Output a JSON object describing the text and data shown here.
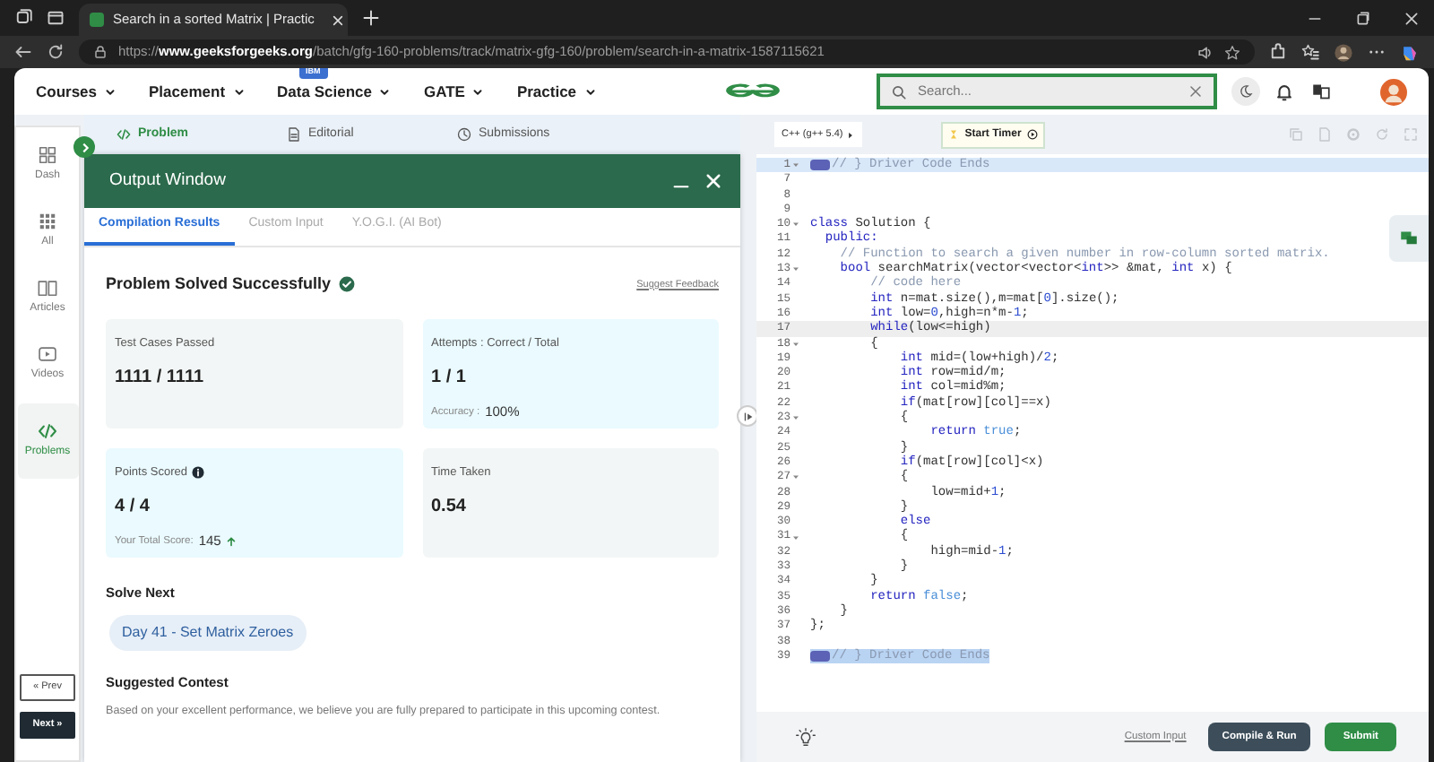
{
  "browser": {
    "tab_title": "Search in a sorted Matrix | Practic",
    "url": "https://**www.geeksforgeeks.org**/batch/gfg-160-problems/track/matrix-gfg-160/problem/search-in-a-matrix-1587115621"
  },
  "nav": {
    "items": [
      {
        "label": "Courses"
      },
      {
        "label": "Placement"
      },
      {
        "label": "Data Science",
        "badge": "IBM"
      },
      {
        "label": "GATE"
      },
      {
        "label": "Practice"
      }
    ],
    "search_placeholder": "Search..."
  },
  "sidebar": {
    "items": [
      {
        "label": "Dash",
        "kind": "dash",
        "selected": false
      },
      {
        "label": "All",
        "kind": "all",
        "selected": false
      },
      {
        "label": "Articles",
        "kind": "book",
        "selected": false
      },
      {
        "label": "Videos",
        "kind": "video",
        "selected": false
      },
      {
        "label": "Problems",
        "kind": "code",
        "selected": true
      }
    ],
    "prev": "« Prev",
    "next": "Next »"
  },
  "problem_tabs": [
    {
      "label": "Problem",
      "kind": "code",
      "selected": true
    },
    {
      "label": "Editorial",
      "kind": "doc",
      "selected": false
    },
    {
      "label": "Submissions",
      "kind": "clock",
      "selected": false
    }
  ],
  "output_window": {
    "title": "Output Window",
    "tabs": [
      {
        "label": "Compilation Results",
        "selected": true
      },
      {
        "label": "Custom Input",
        "selected": false
      },
      {
        "label": "Y.O.G.I. (AI Bot)",
        "selected": false
      }
    ],
    "status": "Problem Solved Successfully",
    "solved": true,
    "feedback_link": "Suggest Feedback",
    "stats": [
      {
        "label": "Test Cases Passed",
        "value": "1111 / 1111",
        "kind": "plain",
        "info_icon": false
      },
      {
        "label": "Attempts : Correct / Total",
        "value": "1 / 1",
        "note_label": "Accuracy :",
        "note_value": "100%",
        "kind": "highlight",
        "info_icon": false,
        "trend_up": false
      },
      {
        "label": "Points Scored",
        "value": "4 / 4",
        "note_label": "Your Total Score:",
        "note_value": "145",
        "trend_up": true,
        "kind": "highlight",
        "info_icon": true
      },
      {
        "label": "Time Taken",
        "value": "0.54",
        "kind": "plain",
        "info_icon": false
      }
    ],
    "solve_next_heading": "Solve Next",
    "solve_next": "Day 41 - Set Matrix Zeroes",
    "contest_heading": "Suggested Contest",
    "contest_text": "Based on your excellent performance, we believe you are fully prepared to participate in this upcoming contest."
  },
  "editor": {
    "language": "C++ (g++ 5.4)",
    "timer": "Start Timer",
    "custom_input": "Custom Input",
    "compile": "Compile & Run",
    "submit": "Submit",
    "lines": [
      {
        "n": "1",
        "fold": true,
        "marker": true,
        "kind": "active",
        "tokens": [
          {
            "text": "// } Driver Code Ends",
            "kind": "comment"
          }
        ]
      },
      {
        "n": "7",
        "fold": false,
        "marker": false,
        "kind": "plain"
      },
      {
        "n": "8",
        "fold": false,
        "marker": false,
        "kind": "plain"
      },
      {
        "n": "9",
        "fold": false,
        "marker": false,
        "kind": "plain"
      },
      {
        "n": "10",
        "fold": true,
        "marker": false,
        "kind": "plain",
        "tokens": [
          {
            "text": "class",
            "kind": "keyword"
          },
          {
            "text": " Solution {",
            "kind": "plain"
          }
        ]
      },
      {
        "n": "11",
        "fold": false,
        "marker": false,
        "kind": "plain",
        "tokens": [
          {
            "text": "  public:",
            "kind": "keyword"
          }
        ]
      },
      {
        "n": "12",
        "fold": false,
        "marker": false,
        "kind": "plain",
        "tokens": [
          {
            "text": "    // Function to search a given number in row-column sorted matrix.",
            "kind": "comment"
          }
        ]
      },
      {
        "n": "13",
        "fold": true,
        "marker": false,
        "kind": "plain",
        "tokens": [
          {
            "text": "    bool",
            "kind": "keyword"
          },
          {
            "text": " searchMatrix(vector<vector<",
            "kind": "plain"
          },
          {
            "text": "int",
            "kind": "keyword"
          },
          {
            "text": ">> &mat, ",
            "kind": "plain"
          },
          {
            "text": "int",
            "kind": "keyword"
          },
          {
            "text": " x) {",
            "kind": "plain"
          }
        ]
      },
      {
        "n": "14",
        "fold": false,
        "marker": false,
        "kind": "plain",
        "tokens": [
          {
            "text": "        // code here",
            "kind": "comment"
          }
        ]
      },
      {
        "n": "15",
        "fold": false,
        "marker": false,
        "kind": "plain",
        "tokens": [
          {
            "text": "        int",
            "kind": "keyword"
          },
          {
            "text": " n=mat.size(),m=mat[",
            "kind": "plain"
          },
          {
            "text": "0",
            "kind": "number"
          },
          {
            "text": "].size();",
            "kind": "plain"
          }
        ]
      },
      {
        "n": "16",
        "fold": false,
        "marker": false,
        "kind": "plain",
        "tokens": [
          {
            "text": "        int",
            "kind": "keyword"
          },
          {
            "text": " low=",
            "kind": "plain"
          },
          {
            "text": "0",
            "kind": "number"
          },
          {
            "text": ",high=n*m-",
            "kind": "plain"
          },
          {
            "text": "1",
            "kind": "number"
          },
          {
            "text": ";",
            "kind": "plain"
          }
        ]
      },
      {
        "n": "17",
        "fold": false,
        "marker": false,
        "kind": "cursor",
        "tokens": [
          {
            "text": "        while",
            "kind": "keyword"
          },
          {
            "text": "(low<=high)",
            "kind": "plain"
          }
        ]
      },
      {
        "n": "18",
        "fold": true,
        "marker": false,
        "kind": "plain",
        "tokens": [
          {
            "text": "        {",
            "kind": "plain"
          }
        ]
      },
      {
        "n": "19",
        "fold": false,
        "marker": false,
        "kind": "plain",
        "tokens": [
          {
            "text": "            int",
            "kind": "keyword"
          },
          {
            "text": " mid=(low+high)/",
            "kind": "plain"
          },
          {
            "text": "2",
            "kind": "number"
          },
          {
            "text": ";",
            "kind": "plain"
          }
        ]
      },
      {
        "n": "20",
        "fold": false,
        "marker": false,
        "kind": "plain",
        "tokens": [
          {
            "text": "            int",
            "kind": "keyword"
          },
          {
            "text": " row=mid/m;",
            "kind": "plain"
          }
        ]
      },
      {
        "n": "21",
        "fold": false,
        "marker": false,
        "kind": "plain",
        "tokens": [
          {
            "text": "            int",
            "kind": "keyword"
          },
          {
            "text": " col=mid%m;",
            "kind": "plain"
          }
        ]
      },
      {
        "n": "22",
        "fold": false,
        "marker": false,
        "kind": "plain",
        "tokens": [
          {
            "text": "            if",
            "kind": "keyword"
          },
          {
            "text": "(mat[row][col]==x)",
            "kind": "plain"
          }
        ]
      },
      {
        "n": "23",
        "fold": true,
        "marker": false,
        "kind": "plain",
        "tokens": [
          {
            "text": "            {",
            "kind": "plain"
          }
        ]
      },
      {
        "n": "24",
        "fold": false,
        "marker": false,
        "kind": "plain",
        "tokens": [
          {
            "text": "                return ",
            "kind": "keyword"
          },
          {
            "text": "true",
            "kind": "boolean"
          },
          {
            "text": ";",
            "kind": "plain"
          }
        ]
      },
      {
        "n": "25",
        "fold": false,
        "marker": false,
        "kind": "plain",
        "tokens": [
          {
            "text": "            }",
            "kind": "plain"
          }
        ]
      },
      {
        "n": "26",
        "fold": false,
        "marker": false,
        "kind": "plain",
        "tokens": [
          {
            "text": "            if",
            "kind": "keyword"
          },
          {
            "text": "(mat[row][col]<x)",
            "kind": "plain"
          }
        ]
      },
      {
        "n": "27",
        "fold": true,
        "marker": false,
        "kind": "plain",
        "tokens": [
          {
            "text": "            {",
            "kind": "plain"
          }
        ]
      },
      {
        "n": "28",
        "fold": false,
        "marker": false,
        "kind": "plain",
        "tokens": [
          {
            "text": "                low=mid+",
            "kind": "plain"
          },
          {
            "text": "1",
            "kind": "number"
          },
          {
            "text": ";",
            "kind": "plain"
          }
        ]
      },
      {
        "n": "29",
        "fold": false,
        "marker": false,
        "kind": "plain",
        "tokens": [
          {
            "text": "            }",
            "kind": "plain"
          }
        ]
      },
      {
        "n": "30",
        "fold": false,
        "marker": false,
        "kind": "plain",
        "tokens": [
          {
            "text": "            else",
            "kind": "keyword"
          }
        ]
      },
      {
        "n": "31",
        "fold": true,
        "marker": false,
        "kind": "plain",
        "tokens": [
          {
            "text": "            {",
            "kind": "plain"
          }
        ]
      },
      {
        "n": "32",
        "fold": false,
        "marker": false,
        "kind": "plain",
        "tokens": [
          {
            "text": "                high=mid-",
            "kind": "plain"
          },
          {
            "text": "1",
            "kind": "number"
          },
          {
            "text": ";",
            "kind": "plain"
          }
        ]
      },
      {
        "n": "33",
        "fold": false,
        "marker": false,
        "kind": "plain",
        "tokens": [
          {
            "text": "            }",
            "kind": "plain"
          }
        ]
      },
      {
        "n": "34",
        "fold": false,
        "marker": false,
        "kind": "plain",
        "tokens": [
          {
            "text": "        }",
            "kind": "plain"
          }
        ]
      },
      {
        "n": "35",
        "fold": false,
        "marker": false,
        "kind": "plain",
        "tokens": [
          {
            "text": "        return ",
            "kind": "keyword"
          },
          {
            "text": "false",
            "kind": "boolean"
          },
          {
            "text": ";",
            "kind": "plain"
          }
        ]
      },
      {
        "n": "36",
        "fold": false,
        "marker": false,
        "kind": "plain",
        "tokens": [
          {
            "text": "    }",
            "kind": "plain"
          }
        ]
      },
      {
        "n": "37",
        "fold": false,
        "marker": false,
        "kind": "plain",
        "tokens": [
          {
            "text": "};",
            "kind": "plain"
          }
        ]
      },
      {
        "n": "38",
        "fold": false,
        "marker": false,
        "kind": "plain"
      },
      {
        "n": "39",
        "fold": false,
        "marker": true,
        "kind": "selected",
        "tokens": [
          {
            "text": "// } Driver Code Ends",
            "kind": "comment"
          }
        ]
      }
    ]
  }
}
